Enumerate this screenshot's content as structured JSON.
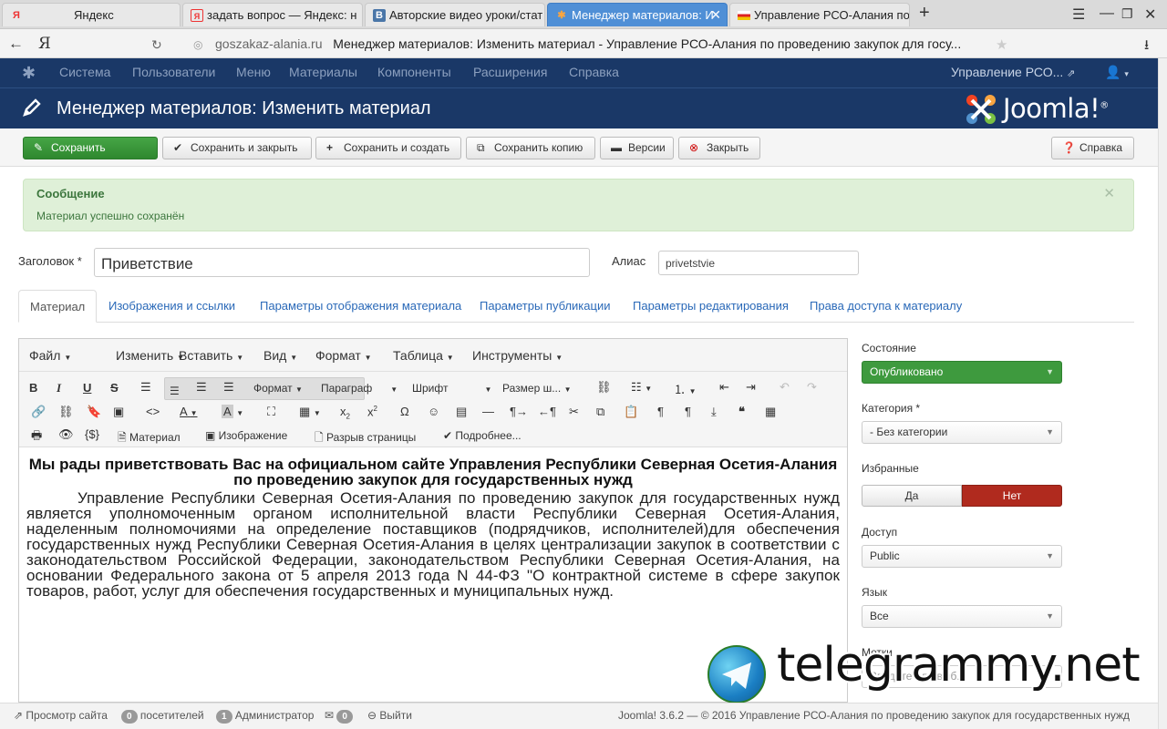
{
  "browser": {
    "tabs": [
      {
        "label": "Яндекс",
        "favicon": "Я"
      },
      {
        "label": "задать вопрос — Яндекс: н",
        "favicon": "Я"
      },
      {
        "label": "Авторские видео уроки/стат",
        "favicon": "В"
      },
      {
        "label": "Менеджер материалов: И",
        "favicon": "J",
        "active": true
      },
      {
        "label": "Управление РСО-Алания по",
        "favicon": "flag"
      }
    ],
    "address": {
      "domain": "goszakaz-alania.ru",
      "page_title": "Менеджер материалов: Изменить материал - Управление РСО-Алания по проведению закупок для госу...",
      "logo": "Я"
    }
  },
  "admin_menu": {
    "items": [
      "Система",
      "Пользователи",
      "Меню",
      "Материалы",
      "Компоненты",
      "Расширения",
      "Справка"
    ],
    "site_link": "Управление РСО...",
    "user_icon": "user-icon"
  },
  "header": {
    "title": "Менеджер материалов: Изменить материал",
    "logo_text": "Joomla!",
    "logo_reg": "®"
  },
  "toolbar": {
    "save": "Сохранить",
    "save_close": "Сохранить и закрыть",
    "save_new": "Сохранить и создать",
    "save_copy": "Сохранить копию",
    "versions": "Версии",
    "close": "Закрыть",
    "help": "Справка"
  },
  "message": {
    "heading": "Сообщение",
    "text": "Материал успешно сохранён"
  },
  "form": {
    "title_label": "Заголовок *",
    "title_value": "Приветствие",
    "alias_label": "Алиас",
    "alias_value": "privetstvie"
  },
  "content_tabs": [
    "Материал",
    "Изображения и ссылки",
    "Параметры отображения материала",
    "Параметры публикации",
    "Параметры редактирования",
    "Права доступа к материалу"
  ],
  "editor": {
    "menu": [
      "Файл",
      "Изменить",
      "Вставить",
      "Вид",
      "Формат",
      "Таблица",
      "Инструменты"
    ],
    "dropdowns": {
      "format": "Формат",
      "paragraph": "Параграф",
      "font": "Шрифт",
      "size": "Размер ш..."
    },
    "buttons": {
      "article": "Материал",
      "image": "Изображение",
      "pagebreak": "Разрыв страницы",
      "readmore": "Подробнее..."
    },
    "heading": "Мы рады приветствовать Вас на официальном сайте Управления Республики Северная Осетия-Алания по проведению закупок для государственных нужд",
    "body": "Управление Республики Северная Осетия-Алания по проведению закупок для государственных нужд является уполномоченным органом исполнительной власти Республики Северная Осетия-Алания, наделенным полномочиями на определение поставщиков (подрядчиков, исполнителей)для обеспечения государственных нужд Республики Северная Осетия-Алания в целях централизации закупок в соответствии с законодательством Российской Федерации, законодательством Республики Северная Осетия-Алания, на основании Федерального закона от 5 апреля 2013 года N 44-ФЗ \"О контрактной системе в сфере закупок товаров, работ, услуг для обеспечения государственных и муниципальных нужд."
  },
  "sidebar": {
    "state_label": "Состояние",
    "state_value": "Опубликовано",
    "category_label": "Категория *",
    "category_value": "- Без категории",
    "featured_label": "Избранные",
    "featured_yes": "Да",
    "featured_no": "Нет",
    "access_label": "Доступ",
    "access_value": "Public",
    "language_label": "Язык",
    "language_value": "Все",
    "tags_label": "Метки",
    "tags_placeholder": "Введите или выб..."
  },
  "watermark": "telegrammy.net",
  "statusbar": {
    "view_site": "Просмотр сайта",
    "visitors_count": "0",
    "visitors_label": "посетителей",
    "admins_count": "1",
    "admins_label": "Администратор",
    "messages_count": "0",
    "logout": "Выйти",
    "footer": "Joomla! 3.6.2 — © 2016 Управление РСО-Алания по проведению закупок для государственных нужд"
  },
  "colors": {
    "admin_nav": "#1a3867",
    "save_green": "#3e9a3e",
    "no_red": "#b02a1e",
    "message_bg": "#dff0d8",
    "link_blue": "#2a69b8"
  }
}
